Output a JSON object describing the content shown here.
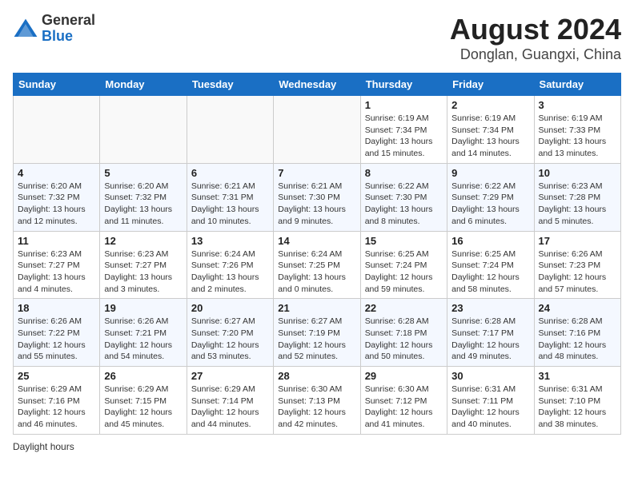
{
  "header": {
    "logo_line1": "General",
    "logo_line2": "Blue",
    "title": "August 2024",
    "subtitle": "Donglan, Guangxi, China"
  },
  "days_of_week": [
    "Sunday",
    "Monday",
    "Tuesday",
    "Wednesday",
    "Thursday",
    "Friday",
    "Saturday"
  ],
  "weeks": [
    [
      {
        "day": "",
        "info": ""
      },
      {
        "day": "",
        "info": ""
      },
      {
        "day": "",
        "info": ""
      },
      {
        "day": "",
        "info": ""
      },
      {
        "day": "1",
        "info": "Sunrise: 6:19 AM\nSunset: 7:34 PM\nDaylight: 13 hours and 15 minutes."
      },
      {
        "day": "2",
        "info": "Sunrise: 6:19 AM\nSunset: 7:34 PM\nDaylight: 13 hours and 14 minutes."
      },
      {
        "day": "3",
        "info": "Sunrise: 6:19 AM\nSunset: 7:33 PM\nDaylight: 13 hours and 13 minutes."
      }
    ],
    [
      {
        "day": "4",
        "info": "Sunrise: 6:20 AM\nSunset: 7:32 PM\nDaylight: 13 hours and 12 minutes."
      },
      {
        "day": "5",
        "info": "Sunrise: 6:20 AM\nSunset: 7:32 PM\nDaylight: 13 hours and 11 minutes."
      },
      {
        "day": "6",
        "info": "Sunrise: 6:21 AM\nSunset: 7:31 PM\nDaylight: 13 hours and 10 minutes."
      },
      {
        "day": "7",
        "info": "Sunrise: 6:21 AM\nSunset: 7:30 PM\nDaylight: 13 hours and 9 minutes."
      },
      {
        "day": "8",
        "info": "Sunrise: 6:22 AM\nSunset: 7:30 PM\nDaylight: 13 hours and 8 minutes."
      },
      {
        "day": "9",
        "info": "Sunrise: 6:22 AM\nSunset: 7:29 PM\nDaylight: 13 hours and 6 minutes."
      },
      {
        "day": "10",
        "info": "Sunrise: 6:23 AM\nSunset: 7:28 PM\nDaylight: 13 hours and 5 minutes."
      }
    ],
    [
      {
        "day": "11",
        "info": "Sunrise: 6:23 AM\nSunset: 7:27 PM\nDaylight: 13 hours and 4 minutes."
      },
      {
        "day": "12",
        "info": "Sunrise: 6:23 AM\nSunset: 7:27 PM\nDaylight: 13 hours and 3 minutes."
      },
      {
        "day": "13",
        "info": "Sunrise: 6:24 AM\nSunset: 7:26 PM\nDaylight: 13 hours and 2 minutes."
      },
      {
        "day": "14",
        "info": "Sunrise: 6:24 AM\nSunset: 7:25 PM\nDaylight: 13 hours and 0 minutes."
      },
      {
        "day": "15",
        "info": "Sunrise: 6:25 AM\nSunset: 7:24 PM\nDaylight: 12 hours and 59 minutes."
      },
      {
        "day": "16",
        "info": "Sunrise: 6:25 AM\nSunset: 7:24 PM\nDaylight: 12 hours and 58 minutes."
      },
      {
        "day": "17",
        "info": "Sunrise: 6:26 AM\nSunset: 7:23 PM\nDaylight: 12 hours and 57 minutes."
      }
    ],
    [
      {
        "day": "18",
        "info": "Sunrise: 6:26 AM\nSunset: 7:22 PM\nDaylight: 12 hours and 55 minutes."
      },
      {
        "day": "19",
        "info": "Sunrise: 6:26 AM\nSunset: 7:21 PM\nDaylight: 12 hours and 54 minutes."
      },
      {
        "day": "20",
        "info": "Sunrise: 6:27 AM\nSunset: 7:20 PM\nDaylight: 12 hours and 53 minutes."
      },
      {
        "day": "21",
        "info": "Sunrise: 6:27 AM\nSunset: 7:19 PM\nDaylight: 12 hours and 52 minutes."
      },
      {
        "day": "22",
        "info": "Sunrise: 6:28 AM\nSunset: 7:18 PM\nDaylight: 12 hours and 50 minutes."
      },
      {
        "day": "23",
        "info": "Sunrise: 6:28 AM\nSunset: 7:17 PM\nDaylight: 12 hours and 49 minutes."
      },
      {
        "day": "24",
        "info": "Sunrise: 6:28 AM\nSunset: 7:16 PM\nDaylight: 12 hours and 48 minutes."
      }
    ],
    [
      {
        "day": "25",
        "info": "Sunrise: 6:29 AM\nSunset: 7:16 PM\nDaylight: 12 hours and 46 minutes."
      },
      {
        "day": "26",
        "info": "Sunrise: 6:29 AM\nSunset: 7:15 PM\nDaylight: 12 hours and 45 minutes."
      },
      {
        "day": "27",
        "info": "Sunrise: 6:29 AM\nSunset: 7:14 PM\nDaylight: 12 hours and 44 minutes."
      },
      {
        "day": "28",
        "info": "Sunrise: 6:30 AM\nSunset: 7:13 PM\nDaylight: 12 hours and 42 minutes."
      },
      {
        "day": "29",
        "info": "Sunrise: 6:30 AM\nSunset: 7:12 PM\nDaylight: 12 hours and 41 minutes."
      },
      {
        "day": "30",
        "info": "Sunrise: 6:31 AM\nSunset: 7:11 PM\nDaylight: 12 hours and 40 minutes."
      },
      {
        "day": "31",
        "info": "Sunrise: 6:31 AM\nSunset: 7:10 PM\nDaylight: 12 hours and 38 minutes."
      }
    ]
  ],
  "footer": {
    "label": "Daylight hours"
  }
}
